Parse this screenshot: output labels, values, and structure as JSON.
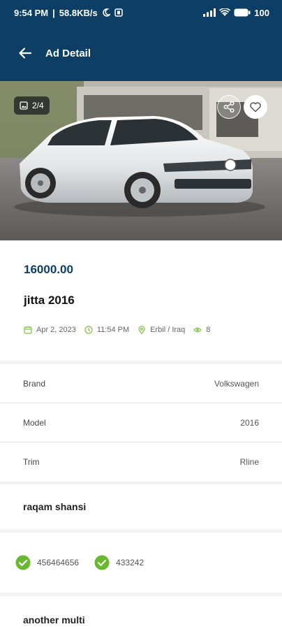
{
  "status_bar": {
    "time": "9:54 PM",
    "speed": "58.8KB/s",
    "battery": "100",
    "icons": [
      "moon-icon",
      "notification-icon",
      "signal-icon",
      "wifi-icon",
      "battery-icon"
    ]
  },
  "appbar": {
    "title": "Ad Detail",
    "back_icon": "arrow-left-icon"
  },
  "gallery": {
    "counter": "2/4",
    "icons": [
      "image-icon",
      "share-icon",
      "heart-icon"
    ]
  },
  "ad": {
    "price": "16000.00",
    "title": "jitta 2016",
    "date": "Apr 2, 2023",
    "time": "11:54 PM",
    "location": "Erbil / Iraq",
    "views": "8"
  },
  "specs": [
    {
      "label": "Brand",
      "value": "Volkswagen"
    },
    {
      "label": "Model",
      "value": "2016"
    },
    {
      "label": "Trim",
      "value": "Rline"
    }
  ],
  "section1": {
    "title": "raqam shansi",
    "items": [
      "456464656",
      "433242"
    ]
  },
  "section2": {
    "title": "another multi"
  },
  "colors": {
    "primary": "#0d3f66",
    "accent_green": "#7cc142",
    "check_green": "#6ab82f"
  }
}
